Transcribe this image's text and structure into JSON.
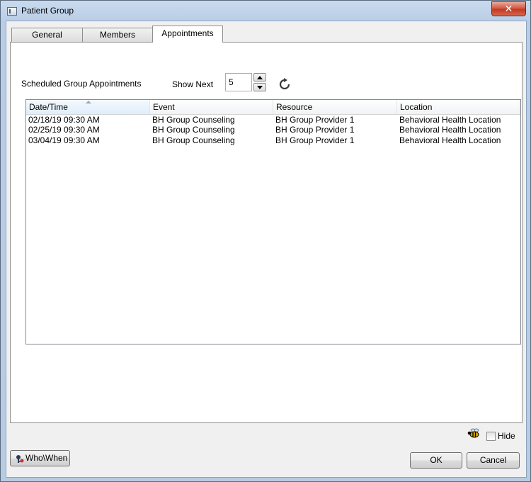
{
  "window": {
    "title": "Patient Group",
    "close_label": "✕"
  },
  "tabs": [
    {
      "label": "General",
      "active": false
    },
    {
      "label": "Members",
      "active": false
    },
    {
      "label": "Appointments",
      "active": true
    }
  ],
  "appointments": {
    "heading": "Scheduled Group Appointments",
    "show_next_label": "Show Next",
    "show_next_value": "5",
    "refresh_icon": "refresh-icon",
    "columns": [
      "Date/Time",
      "Event",
      "Resource",
      "Location"
    ],
    "rows": [
      [
        "02/18/19 09:30 AM",
        "BH Group Counseling",
        "BH Group Provider 1",
        "Behavioral Health Location"
      ],
      [
        "02/25/19 09:30 AM",
        "BH Group Counseling",
        "BH Group Provider 1",
        "Behavioral Health Location"
      ],
      [
        "03/04/19 09:30 AM",
        "BH Group Counseling",
        "BH Group Provider 1",
        "Behavioral Health Location"
      ]
    ]
  },
  "footer": {
    "hide_label": "Hide",
    "hide_checked": false,
    "whowhen_label": "Who\\When",
    "ok_label": "OK",
    "cancel_label": "Cancel"
  }
}
